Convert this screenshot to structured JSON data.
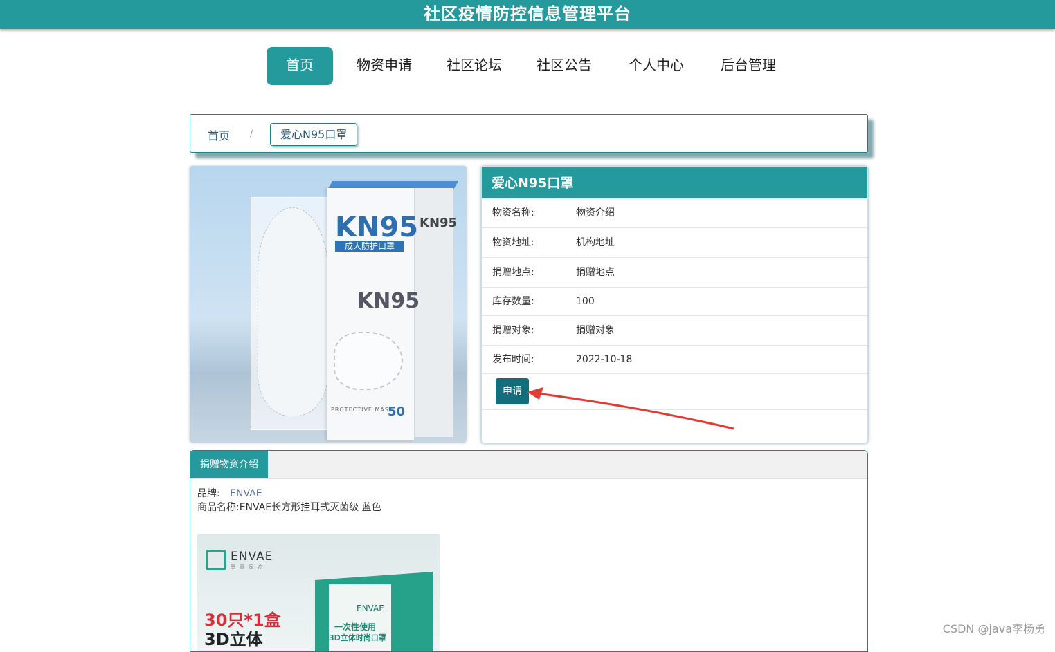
{
  "header": {
    "title": "社区疫情防控信息管理平台"
  },
  "nav": {
    "items": [
      "首页",
      "物资申请",
      "社区论坛",
      "社区公告",
      "个人中心",
      "后台管理"
    ],
    "active_index": 0
  },
  "breadcrumb": {
    "home": "首页",
    "separator": "/",
    "current": "爱心N95口罩"
  },
  "product_image": {
    "kn95_big": "KN95",
    "subtitle": "成人防护口罩",
    "kn95_mid": "KN95",
    "kn95_side": "KN95",
    "count": "50",
    "protective": "PROTECTIVE MASK"
  },
  "info": {
    "title": "爱心N95口罩",
    "rows": [
      {
        "label": "物资名称:",
        "value": "物资介绍"
      },
      {
        "label": "物资地址:",
        "value": "机构地址"
      },
      {
        "label": "捐赠地点:",
        "value": "捐赠地点"
      },
      {
        "label": "库存数量:",
        "value": "100"
      },
      {
        "label": "捐赠对象:",
        "value": "捐赠对象"
      },
      {
        "label": "发布时间:",
        "value": "2022-10-18"
      }
    ],
    "apply_label": "申请"
  },
  "tab": {
    "label": "捐赠物资介绍",
    "brand_label": "品牌:",
    "brand_value": "ENVAE",
    "name_line": "商品名称:ENVAE长方形挂耳式灭菌级 蓝色"
  },
  "envae_image": {
    "name": "ENVAE",
    "count_text": "30只*1盒",
    "text_3d": "3D立体",
    "box_name": "ENVAE",
    "box_line1": "一次性使用",
    "box_line2": "3D立体时尚口罩"
  },
  "watermark": "CSDN @java李杨勇",
  "colors": {
    "primary": "#259a9c",
    "button": "#126e7a",
    "arrow": "#e53935"
  }
}
